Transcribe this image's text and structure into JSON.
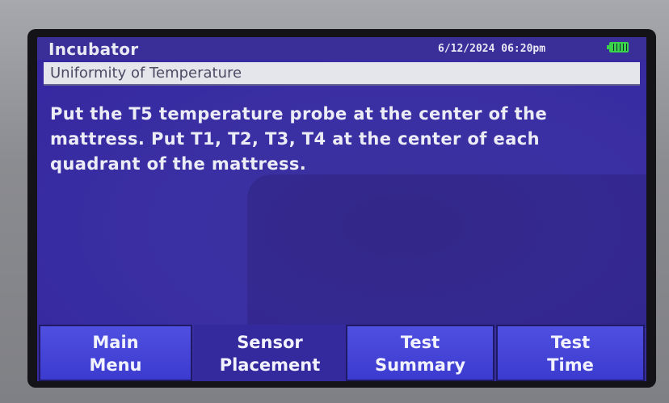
{
  "header": {
    "app_title": "Incubator",
    "datetime": "6/12/2024 06:20pm",
    "battery_icon": "battery-full-icon",
    "battery_color": "#39d24a"
  },
  "subtitle": "Uniformity of Temperature",
  "instruction": "Put the T5 temperature probe at the center of the mattress. Put T1, T2, T3, T4 at the center of each quadrant of the mattress.",
  "softkeys": [
    {
      "line1": "Main",
      "line2": "Menu",
      "active": false
    },
    {
      "line1": "Sensor",
      "line2": "Placement",
      "active": true
    },
    {
      "line1": "Test",
      "line2": "Summary",
      "active": false
    },
    {
      "line1": "Test",
      "line2": "Time",
      "active": false
    }
  ],
  "colors": {
    "screen_bg": "#3b30a3",
    "softkey_bg": "#4545d8",
    "subtitle_bg": "#e5e6ec"
  }
}
